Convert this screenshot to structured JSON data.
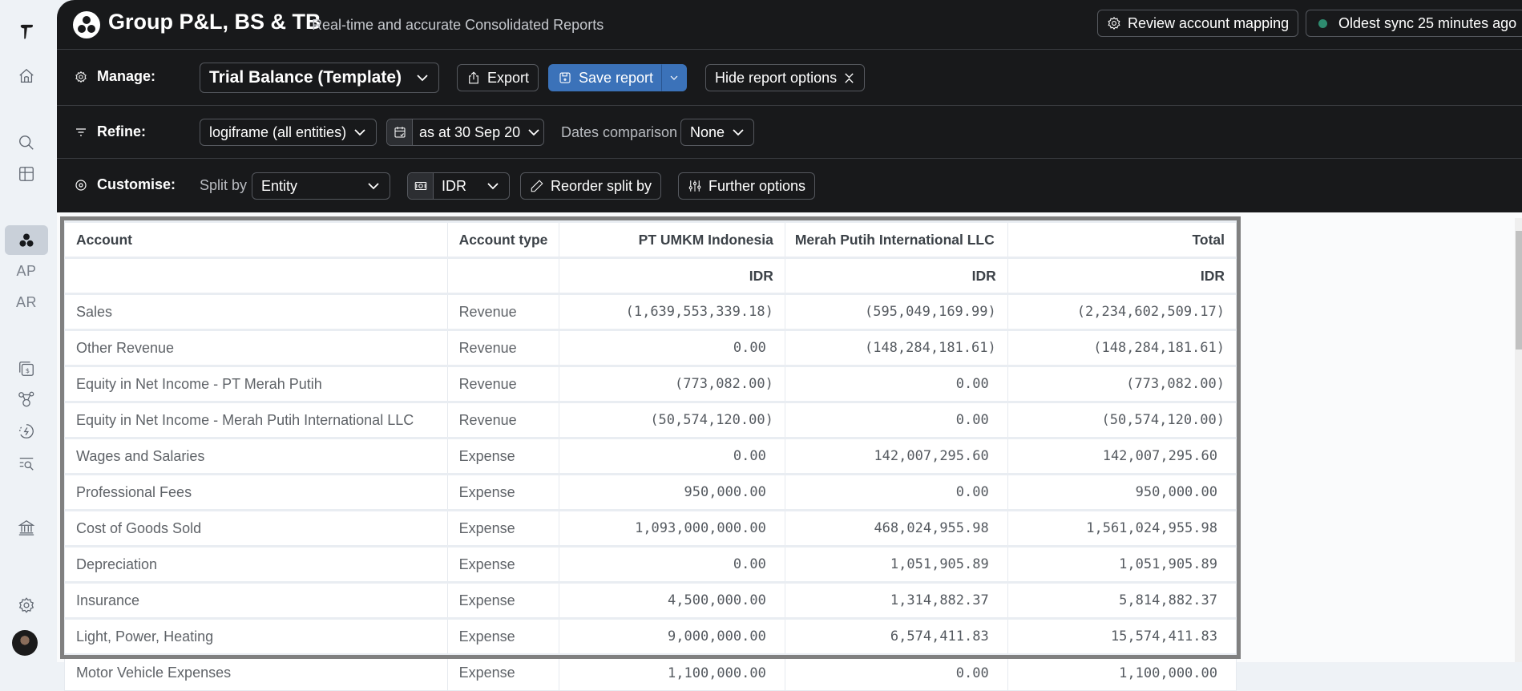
{
  "sidebar": {
    "items": [
      {
        "name": "logo",
        "icon": "brand-logo-icon"
      },
      {
        "name": "home",
        "icon": "home-icon"
      },
      {
        "name": "search",
        "icon": "search-icon"
      },
      {
        "name": "table",
        "icon": "table-icon"
      },
      {
        "name": "group-reports",
        "icon": "group-icon",
        "active": true
      },
      {
        "name": "ap",
        "label": "AP"
      },
      {
        "name": "ar",
        "label": "AR"
      },
      {
        "name": "cash",
        "icon": "dollar-cards-icon"
      },
      {
        "name": "network",
        "icon": "network-icon"
      },
      {
        "name": "sync",
        "icon": "lightning-cycle-icon"
      },
      {
        "name": "list-search",
        "icon": "list-search-icon"
      },
      {
        "name": "bank",
        "icon": "bank-icon"
      },
      {
        "name": "settings",
        "icon": "gear-icon"
      }
    ]
  },
  "header": {
    "title": "Group P&L, BS & TB",
    "subtitle": "Real-time and accurate Consolidated Reports",
    "review_label": "Review account mapping",
    "sync_label": "Oldest sync 25 minutes ago",
    "sync_status_color": "#2e8b6f"
  },
  "manage": {
    "label": "Manage:",
    "report_select": "Trial Balance (Template)",
    "export_label": "Export",
    "save_label": "Save report",
    "hide_label": "Hide report options"
  },
  "refine": {
    "label": "Refine:",
    "entity_select": "logiframe (all entities)",
    "date_select": "as at 30 Sep 20",
    "comparison_label": "Dates comparison",
    "comparison_select": "None"
  },
  "customise": {
    "label": "Customise:",
    "split_label": "Split by",
    "split_select": "Entity",
    "currency_select": "IDR",
    "reorder_label": "Reorder split by",
    "further_label": "Further options"
  },
  "table": {
    "headers": [
      "Account",
      "Account type",
      "PT UMKM Indonesia",
      "Merah Putih International LLC",
      "Total"
    ],
    "currency_row": [
      "",
      "",
      "IDR",
      "IDR",
      "IDR"
    ],
    "rows": [
      [
        "Sales",
        "Revenue",
        "(1,639,553,339.18)",
        "(595,049,169.99)",
        "(2,234,602,509.17)"
      ],
      [
        "Other Revenue",
        "Revenue",
        "0.00",
        "(148,284,181.61)",
        "(148,284,181.61)"
      ],
      [
        "Equity in Net Income - PT Merah Putih",
        "Revenue",
        "(773,082.00)",
        "0.00",
        "(773,082.00)"
      ],
      [
        "Equity in Net Income - Merah Putih International LLC",
        "Revenue",
        "(50,574,120.00)",
        "0.00",
        "(50,574,120.00)"
      ],
      [
        "Wages and Salaries",
        "Expense",
        "0.00",
        "142,007,295.60",
        "142,007,295.60"
      ],
      [
        "Professional Fees",
        "Expense",
        "950,000.00",
        "0.00",
        "950,000.00"
      ],
      [
        "Cost of Goods Sold",
        "Expense",
        "1,093,000,000.00",
        "468,024,955.98",
        "1,561,024,955.98"
      ],
      [
        "Depreciation",
        "Expense",
        "0.00",
        "1,051,905.89",
        "1,051,905.89"
      ],
      [
        "Insurance",
        "Expense",
        "4,500,000.00",
        "1,314,882.37",
        "5,814,882.37"
      ],
      [
        "Light, Power, Heating",
        "Expense",
        "9,000,000.00",
        "6,574,411.83",
        "15,574,411.83"
      ],
      [
        "Motor Vehicle Expenses",
        "Expense",
        "1,100,000.00",
        "0.00",
        "1,100,000.00"
      ]
    ]
  }
}
